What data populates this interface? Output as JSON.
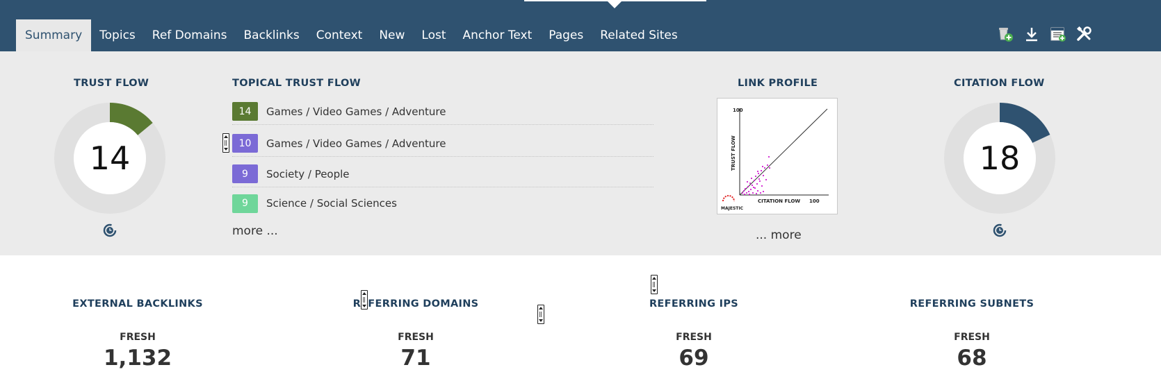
{
  "tabs": [
    {
      "label": "Summary",
      "active": true
    },
    {
      "label": "Topics"
    },
    {
      "label": "Ref Domains"
    },
    {
      "label": "Backlinks"
    },
    {
      "label": "Context"
    },
    {
      "label": "New"
    },
    {
      "label": "Lost"
    },
    {
      "label": "Anchor Text"
    },
    {
      "label": "Pages"
    },
    {
      "label": "Related Sites"
    }
  ],
  "toolbar_icons": [
    "add-to-bucket-icon",
    "download-icon",
    "add-report-icon",
    "tools-icon"
  ],
  "trust_flow": {
    "title": "TRUST FLOW",
    "value": "14",
    "fraction": 0.14,
    "color": "#5a7a32"
  },
  "citation_flow": {
    "title": "CITATION FLOW",
    "value": "18",
    "fraction": 0.18,
    "color": "#2f5270"
  },
  "topical_trust_flow": {
    "title": "TOPICAL TRUST FLOW",
    "items": [
      {
        "value": "14",
        "label": "Games / Video Games / Adventure",
        "color": "#5a7a32"
      },
      {
        "value": "10",
        "label": "Games / Video Games / Adventure",
        "color": "#7b6ad6"
      },
      {
        "value": "9",
        "label": "Society / People",
        "color": "#7b6ad6"
      },
      {
        "value": "9",
        "label": "Science / Social Sciences",
        "color": "#6fd69a"
      }
    ],
    "more": "more ..."
  },
  "link_profile": {
    "title": "LINK PROFILE",
    "y_axis": "TRUST FLOW",
    "x_axis": "CITATION FLOW",
    "y_max": "100",
    "x_max": "100",
    "brand": "MAJESTIC",
    "more": "... more"
  },
  "stats": [
    {
      "title": "EXTERNAL BACKLINKS",
      "sub": "FRESH",
      "value": "1,132"
    },
    {
      "title": "REFERRING DOMAINS",
      "sub": "FRESH",
      "value": "71"
    },
    {
      "title": "REFERRING IPS",
      "sub": "FRESH",
      "value": "69"
    },
    {
      "title": "REFERRING SUBNETS",
      "sub": "FRESH",
      "value": "68"
    }
  ]
}
